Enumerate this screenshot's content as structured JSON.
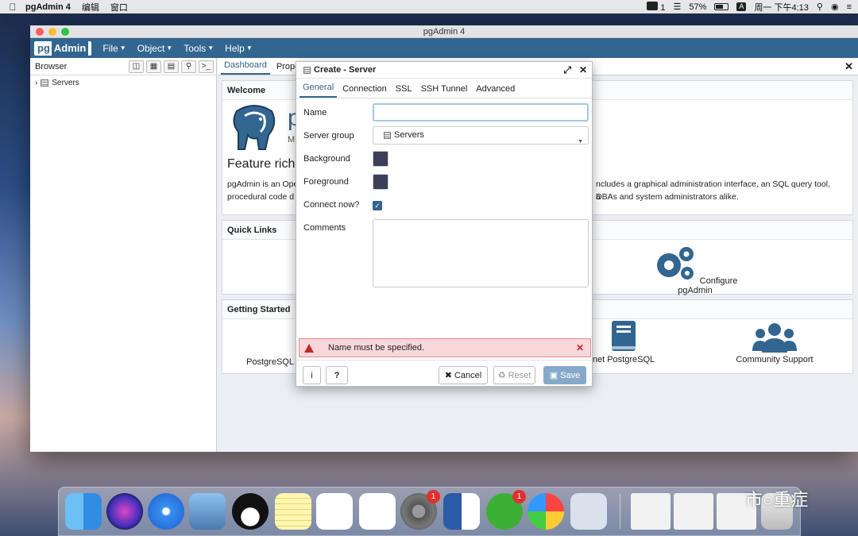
{
  "menubar": {
    "app": "pgAdmin 4",
    "items": [
      "编辑",
      "窗口"
    ],
    "wechat_count": "1",
    "battery": "57%",
    "input_method": "A",
    "clock": "周一 下午4:13"
  },
  "window": {
    "title": "pgAdmin 4"
  },
  "navbar": {
    "logo_pg": "pg",
    "logo_admin": "Admin",
    "menus": [
      "File",
      "Object",
      "Tools",
      "Help"
    ]
  },
  "browser": {
    "title": "Browser",
    "tree_item": "Servers"
  },
  "main": {
    "tabs": [
      "Dashboard",
      "Prope"
    ],
    "welcome": {
      "title": "Welcome",
      "big_letter": "p",
      "big_sub": "M",
      "feature": "Feature rich",
      "intro_line1_left": "pgAdmin is an Ope",
      "intro_line1_right": "ncludes a graphical administration interface, an SQL query tool, a",
      "intro_line2_left": "procedural code d",
      "intro_line2_right": "DBAs and system administrators alike."
    },
    "quick_links": {
      "title": "Quick Links",
      "configure": "Configure pgAdmin"
    },
    "getting_started": {
      "title": "Getting Started",
      "items": [
        "PostgreSQL",
        "net PostgreSQL",
        "Community Support"
      ]
    }
  },
  "dialog": {
    "title": "Create - Server",
    "tabs": [
      "General",
      "Connection",
      "SSL",
      "SSH Tunnel",
      "Advanced"
    ],
    "fields": {
      "name_label": "Name",
      "name_value": "",
      "server_group_label": "Server group",
      "server_group_value": "Servers",
      "background_label": "Background",
      "foreground_label": "Foreground",
      "connect_label": "Connect now?",
      "comments_label": "Comments"
    },
    "error": "Name must be specified.",
    "buttons": {
      "info": "i",
      "help": "?",
      "cancel": "Cancel",
      "reset": "Reset",
      "save": "Save"
    }
  },
  "dock": {
    "badges": [
      "1",
      "1"
    ]
  },
  "watermark": "市○重症",
  "colors": {
    "brand": "#326690",
    "swatch": "#3c3f57",
    "error_bg": "#f8d7da",
    "error": "#c0282d"
  }
}
